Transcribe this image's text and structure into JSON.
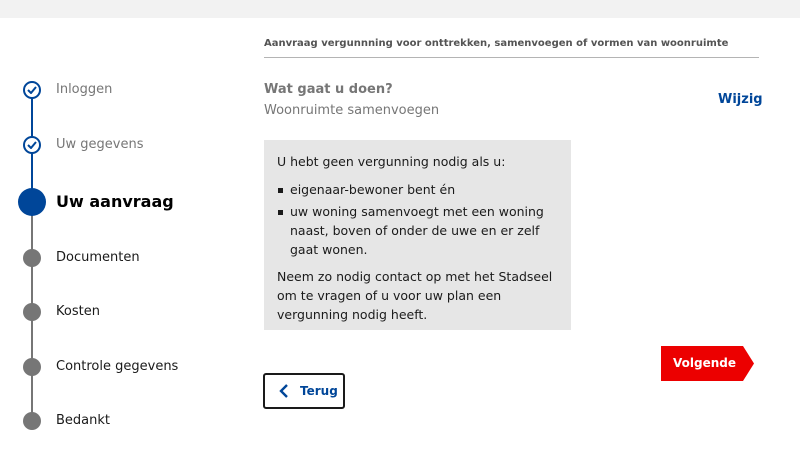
{
  "colors": {
    "brand_blue": "#004699",
    "accent_red": "#ec0000",
    "grey": "#767676",
    "box_bg": "#e6e6e6"
  },
  "stepper": {
    "steps": [
      {
        "label": "Inloggen",
        "state": "done"
      },
      {
        "label": "Uw gegevens",
        "state": "done"
      },
      {
        "label": "Uw aanvraag",
        "state": "current"
      },
      {
        "label": "Documenten",
        "state": "todo"
      },
      {
        "label": "Kosten",
        "state": "todo"
      },
      {
        "label": "Controle gegevens",
        "state": "todo"
      },
      {
        "label": "Bedankt",
        "state": "todo"
      }
    ]
  },
  "form": {
    "title": "Aanvraag vergunnning voor onttrekken, samenvoegen of vormen van woonruimte",
    "question": "Wat gaat u doen?",
    "answer": "Woonruimte samenvoegen",
    "edit_label": "Wijzig"
  },
  "info": {
    "intro": "U hebt geen vergunning nodig als u:",
    "bullets": [
      "eigenaar-bewoner bent én",
      "uw woning samenvoegt met een woning naast, boven of onder de uwe en er zelf gaat wonen."
    ],
    "outro": "Neem zo nodig contact op met het Stadseel om te vragen of u voor uw plan een vergunning nodig heeft."
  },
  "buttons": {
    "next_label": "Volgende",
    "back_label": "Terug"
  },
  "icons": {
    "done": "checkmark-icon",
    "back": "chevron-left-icon"
  }
}
